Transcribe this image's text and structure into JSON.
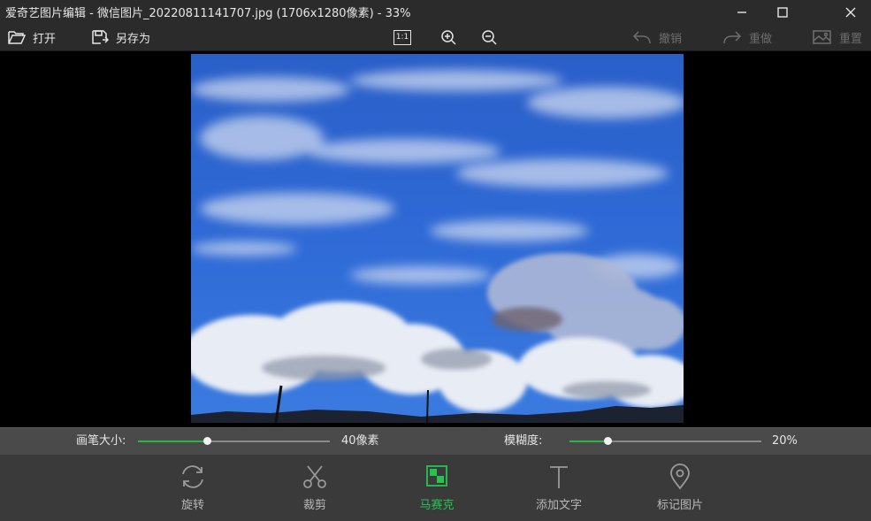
{
  "window": {
    "title": "爱奇艺图片编辑 - 微信图片_20220811141707.jpg (1706x1280像素) - 33%",
    "minimize_icon": "minimize-icon",
    "maximize_icon": "maximize-icon",
    "close_icon": "close-icon"
  },
  "toolbar": {
    "open_label": "打开",
    "saveas_label": "另存为",
    "actual_size_label": "1:1",
    "zoom_in_icon": "zoom-in-icon",
    "zoom_out_icon": "zoom-out-icon",
    "undo_label": "撤销",
    "redo_label": "重做",
    "reset_label": "重置"
  },
  "options": {
    "brush_size_label": "画笔大小:",
    "brush_size_value": "40像素",
    "brush_size_fraction": 0.36,
    "blur_label": "模糊度:",
    "blur_value": "20%",
    "blur_fraction": 0.2
  },
  "tools": [
    {
      "label": "旋转",
      "icon": "rotate-icon",
      "active": false
    },
    {
      "label": "裁剪",
      "icon": "crop-scissors-icon",
      "active": false
    },
    {
      "label": "马赛克",
      "icon": "mosaic-icon",
      "active": true
    },
    {
      "label": "添加文字",
      "icon": "text-icon",
      "active": false
    },
    {
      "label": "标记图片",
      "icon": "location-pin-icon",
      "active": false
    }
  ],
  "colors": {
    "accent": "#27c250",
    "slider_fill": "#2fb34a",
    "chrome": "#2b2b2b",
    "bottom_bar": "#3a3a3a"
  }
}
